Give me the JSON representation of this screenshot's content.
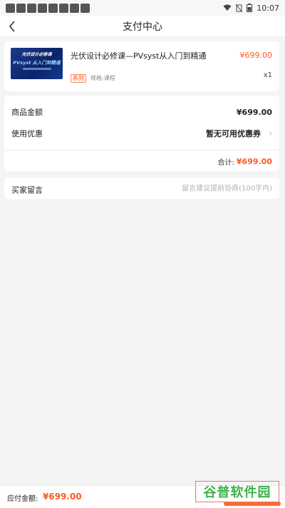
{
  "status_bar": {
    "time": "10:07"
  },
  "nav": {
    "title": "支付中心"
  },
  "product": {
    "title": "光伏设计必修课—PVsyst从入门到精通",
    "price": "¥699.00",
    "tag": "系列",
    "spec": "规格:课程",
    "qty": "x1",
    "thumb_line1": "光伏设计必修课",
    "thumb_line2": "PVsyst 从入门到精通"
  },
  "summary": {
    "amount_label": "商品金额",
    "amount_value": "¥699.00",
    "discount_label": "使用优惠",
    "discount_value": "暂无可用优惠券",
    "total_label": "合计:",
    "total_value": "¥699.00"
  },
  "message": {
    "label": "买家留言",
    "placeholder": "留言建议提前协商(100字内)"
  },
  "bottom": {
    "pay_label": "应付金额:",
    "pay_value": "¥699.00"
  },
  "watermark": {
    "text": "谷普软件园"
  },
  "colors": {
    "accent": "#ff5a1f",
    "background": "#f4f4f4",
    "watermark": "#3bb34a"
  }
}
